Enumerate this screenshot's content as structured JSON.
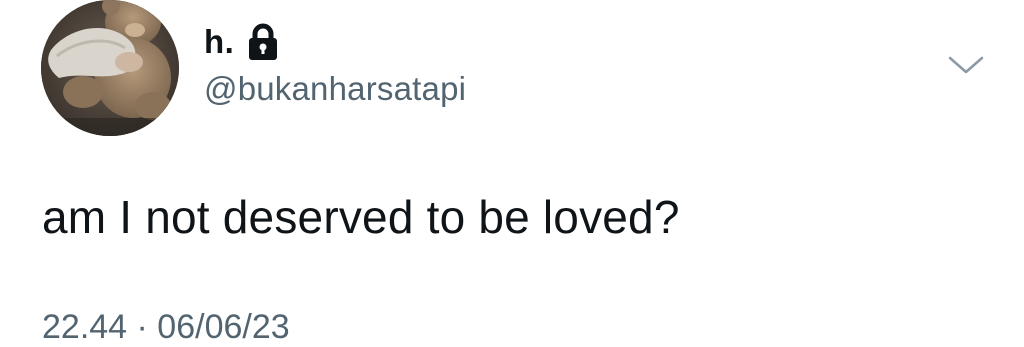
{
  "tweet": {
    "display_name": "h.",
    "handle": "@bukanharsatapi",
    "text": "am I not deserved to be loved?",
    "timestamp": "22.44 · 06/06/23"
  },
  "icons": {
    "lock": "lock-icon",
    "more": "chevron-down-icon",
    "avatar": "avatar"
  },
  "colors": {
    "text": "#0f1419",
    "secondary": "#536471",
    "background": "#ffffff"
  }
}
